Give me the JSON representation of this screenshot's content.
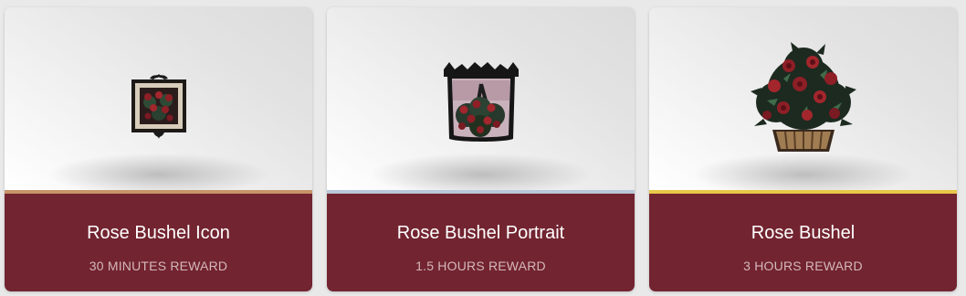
{
  "rewards": [
    {
      "title": "Rose Bushel Icon",
      "subtitle": "30 MINUTES REWARD",
      "tier_color": "#c8956a",
      "icon": "framed-rose-icon"
    },
    {
      "title": "Rose Bushel Portrait",
      "subtitle": "1.5 HOURS REWARD",
      "tier_color": "#b8c8d8",
      "icon": "rose-portrait-icon"
    },
    {
      "title": "Rose Bushel",
      "subtitle": "3 HOURS REWARD",
      "tier_color": "#e8c84a",
      "icon": "rose-bush-icon"
    }
  ],
  "colors": {
    "footer_bg": "#722430",
    "title_text": "#ffffff",
    "subtitle_text": "#d4b8bb"
  }
}
